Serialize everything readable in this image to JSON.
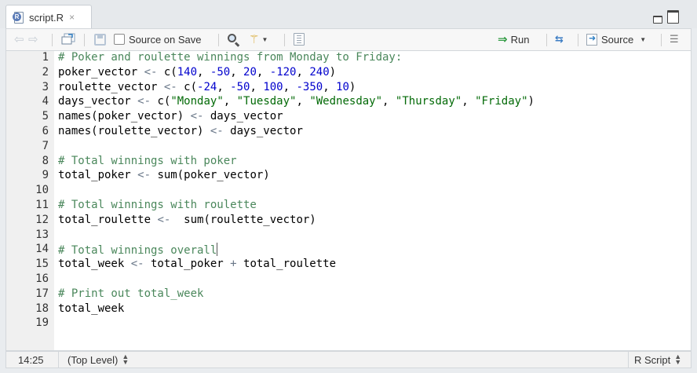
{
  "tab": {
    "title": "script.R",
    "close_glyph": "×",
    "icon": "r-script-file-icon"
  },
  "toolbar": {
    "source_on_save_label": "Source on Save",
    "source_on_save_checked": false,
    "run_label": "Run",
    "source_label": "Source",
    "icons": [
      "back-arrow-icon",
      "forward-arrow-icon",
      "show-in-window-icon",
      "save-icon",
      "search-icon",
      "code-tools-wand-icon",
      "compile-report-icon",
      "run-icon",
      "rerun-icon",
      "source-icon",
      "outline-icon"
    ]
  },
  "editor": {
    "line_numbers": [
      "1",
      "2",
      "3",
      "4",
      "5",
      "6",
      "7",
      "8",
      "9",
      "10",
      "11",
      "12",
      "13",
      "14",
      "15",
      "16",
      "17",
      "18",
      "19"
    ],
    "lines": [
      [
        {
          "t": "# Poker and roulette winnings from Monday to Friday:",
          "c": "comment"
        }
      ],
      [
        {
          "t": "poker_vector ",
          "c": "plain"
        },
        {
          "t": "<-",
          "c": "op"
        },
        {
          "t": " c(",
          "c": "plain"
        },
        {
          "t": "140",
          "c": "number"
        },
        {
          "t": ", ",
          "c": "plain"
        },
        {
          "t": "-50",
          "c": "number"
        },
        {
          "t": ", ",
          "c": "plain"
        },
        {
          "t": "20",
          "c": "number"
        },
        {
          "t": ", ",
          "c": "plain"
        },
        {
          "t": "-120",
          "c": "number"
        },
        {
          "t": ", ",
          "c": "plain"
        },
        {
          "t": "240",
          "c": "number"
        },
        {
          "t": ")",
          "c": "plain"
        }
      ],
      [
        {
          "t": "roulette_vector ",
          "c": "plain"
        },
        {
          "t": "<-",
          "c": "op"
        },
        {
          "t": " c(",
          "c": "plain"
        },
        {
          "t": "-24",
          "c": "number"
        },
        {
          "t": ", ",
          "c": "plain"
        },
        {
          "t": "-50",
          "c": "number"
        },
        {
          "t": ", ",
          "c": "plain"
        },
        {
          "t": "100",
          "c": "number"
        },
        {
          "t": ", ",
          "c": "plain"
        },
        {
          "t": "-350",
          "c": "number"
        },
        {
          "t": ", ",
          "c": "plain"
        },
        {
          "t": "10",
          "c": "number"
        },
        {
          "t": ")",
          "c": "plain"
        }
      ],
      [
        {
          "t": "days_vector ",
          "c": "plain"
        },
        {
          "t": "<-",
          "c": "op"
        },
        {
          "t": " c(",
          "c": "plain"
        },
        {
          "t": "\"Monday\"",
          "c": "string"
        },
        {
          "t": ", ",
          "c": "plain"
        },
        {
          "t": "\"Tuesday\"",
          "c": "string"
        },
        {
          "t": ", ",
          "c": "plain"
        },
        {
          "t": "\"Wednesday\"",
          "c": "string"
        },
        {
          "t": ", ",
          "c": "plain"
        },
        {
          "t": "\"Thursday\"",
          "c": "string"
        },
        {
          "t": ", ",
          "c": "plain"
        },
        {
          "t": "\"Friday\"",
          "c": "string"
        },
        {
          "t": ")",
          "c": "plain"
        }
      ],
      [
        {
          "t": "names(poker_vector) ",
          "c": "plain"
        },
        {
          "t": "<-",
          "c": "op"
        },
        {
          "t": " days_vector",
          "c": "plain"
        }
      ],
      [
        {
          "t": "names(roulette_vector) ",
          "c": "plain"
        },
        {
          "t": "<-",
          "c": "op"
        },
        {
          "t": " days_vector",
          "c": "plain"
        }
      ],
      [],
      [
        {
          "t": "# Total winnings with poker",
          "c": "comment"
        }
      ],
      [
        {
          "t": "total_poker ",
          "c": "plain"
        },
        {
          "t": "<-",
          "c": "op"
        },
        {
          "t": " sum(poker_vector)",
          "c": "plain"
        }
      ],
      [],
      [
        {
          "t": "# Total winnings with roulette",
          "c": "comment"
        }
      ],
      [
        {
          "t": "total_roulette ",
          "c": "plain"
        },
        {
          "t": "<-",
          "c": "op"
        },
        {
          "t": "  sum(roulette_vector)",
          "c": "plain"
        }
      ],
      [],
      [
        {
          "t": "# Total winnings overall",
          "c": "comment"
        },
        {
          "t": "",
          "c": "cursor"
        }
      ],
      [
        {
          "t": "total_week ",
          "c": "plain"
        },
        {
          "t": "<-",
          "c": "op"
        },
        {
          "t": " total_poker ",
          "c": "plain"
        },
        {
          "t": "+",
          "c": "op"
        },
        {
          "t": " total_roulette",
          "c": "plain"
        }
      ],
      [],
      [
        {
          "t": "# Print out total_week",
          "c": "comment"
        }
      ],
      [
        {
          "t": "total_week",
          "c": "plain"
        }
      ],
      []
    ]
  },
  "status": {
    "cursor_position": "14:25",
    "scope": "(Top Level)",
    "file_type": "R Script"
  },
  "colors": {
    "comment": "#4a875b",
    "string": "#036a07",
    "number": "#0000cd",
    "operator": "#687687",
    "run_arrow": "#2f9a41"
  }
}
